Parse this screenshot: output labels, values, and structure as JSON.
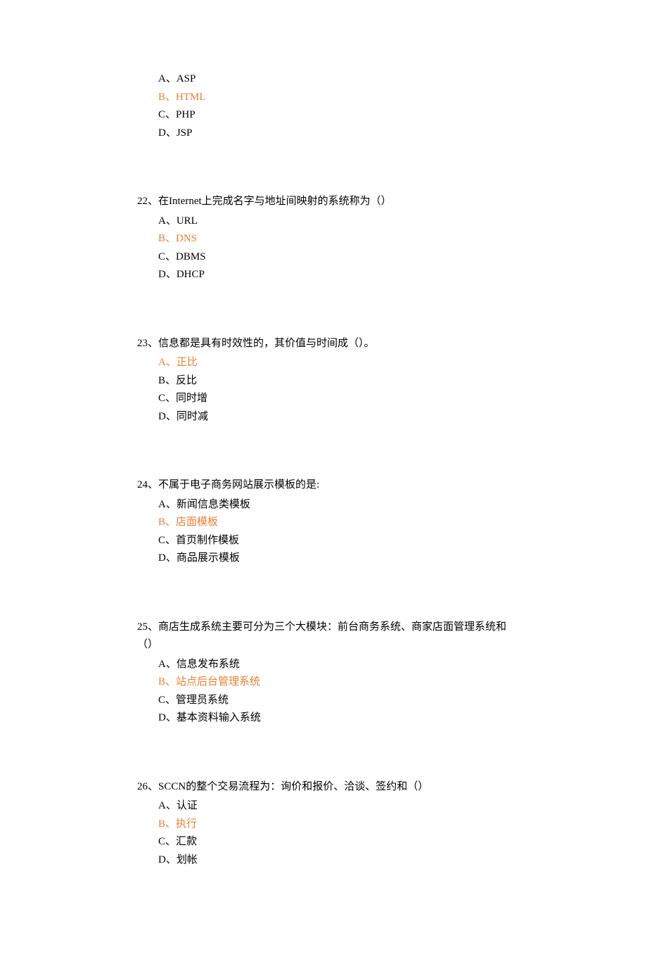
{
  "first_question_options": [
    {
      "label": "A、",
      "text": "ASP",
      "highlight": false
    },
    {
      "label": "B、",
      "text": "HTML",
      "highlight": true
    },
    {
      "label": "C、",
      "text": "PHP",
      "highlight": false
    },
    {
      "label": "D、",
      "text": "JSP",
      "highlight": false
    }
  ],
  "questions": [
    {
      "number": "22、",
      "stem": "在Internet上完成名字与地址间映射的系统称为（）",
      "options": [
        {
          "label": "A、",
          "text": "URL",
          "highlight": false
        },
        {
          "label": "B、",
          "text": "DNS",
          "highlight": true
        },
        {
          "label": "C、",
          "text": "DBMS",
          "highlight": false
        },
        {
          "label": "D、",
          "text": "DHCP",
          "highlight": false
        }
      ]
    },
    {
      "number": "23、",
      "stem": "信息都是具有时效性的，其价值与时间成（）。",
      "options": [
        {
          "label": "A、",
          "text": "正比",
          "highlight": true
        },
        {
          "label": "B、",
          "text": "反比",
          "highlight": false
        },
        {
          "label": "C、",
          "text": "同时增",
          "highlight": false
        },
        {
          "label": "D、",
          "text": "同时减",
          "highlight": false
        }
      ]
    },
    {
      "number": "24、",
      "stem": "不属于电子商务网站展示模板的是:",
      "options": [
        {
          "label": "A、",
          "text": "新闻信息类模板",
          "highlight": false
        },
        {
          "label": "B、",
          "text": "店面模板",
          "highlight": true
        },
        {
          "label": "C、",
          "text": "首页制作模板",
          "highlight": false
        },
        {
          "label": "D、",
          "text": "商品展示模板",
          "highlight": false
        }
      ]
    },
    {
      "number": "25、",
      "stem": "商店生成系统主要可分为三个大模块：前台商务系统、商家店面管理系统和（）",
      "options": [
        {
          "label": "A、",
          "text": "信息发布系统",
          "highlight": false
        },
        {
          "label": "B、",
          "text": "站点后台管理系统",
          "highlight": true
        },
        {
          "label": "C、",
          "text": "管理员系统",
          "highlight": false
        },
        {
          "label": "D、",
          "text": "基本资料输入系统",
          "highlight": false
        }
      ]
    },
    {
      "number": "26、",
      "stem": "SCCN的整个交易流程为：询价和报价、洽谈、签约和（）",
      "options": [
        {
          "label": "A、",
          "text": "认证",
          "highlight": false
        },
        {
          "label": "B、",
          "text": "执行",
          "highlight": true
        },
        {
          "label": "C、",
          "text": "汇款",
          "highlight": false
        },
        {
          "label": "D、",
          "text": "划帐",
          "highlight": false
        }
      ]
    }
  ]
}
